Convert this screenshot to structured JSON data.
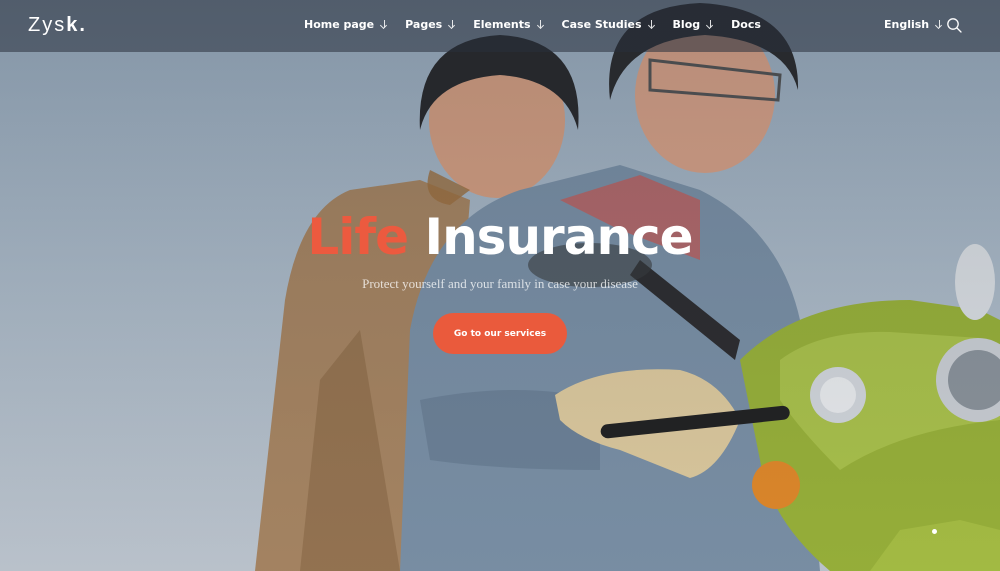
{
  "nav": {
    "logo_regular": "Zys",
    "logo_bold": "k.",
    "menu": [
      {
        "label": "Home page"
      },
      {
        "label": "Pages"
      },
      {
        "label": "Elements"
      },
      {
        "label": "Case Studies"
      },
      {
        "label": "Blog"
      },
      {
        "label": "Docs"
      }
    ],
    "language": "English"
  },
  "hero": {
    "title_accent": "Life",
    "title_rest": " Insurance",
    "subtitle": "Protect yourself and your family in case your disease",
    "cta_label": "Go to our services"
  },
  "colors": {
    "accent": "#ea5a3c",
    "nav_bg": "rgba(40,48,60,0.55)"
  }
}
